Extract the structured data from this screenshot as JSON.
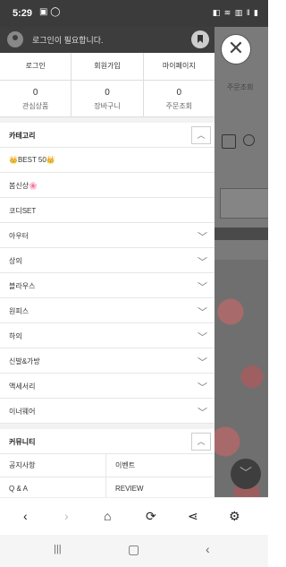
{
  "status": {
    "time": "5:29",
    "left_icons": "▣ ◯",
    "right_icons": "◧ ≋ ▥ ‖ ▮"
  },
  "drawer": {
    "login_msg": "로그인이 필요합니다.",
    "top_links": [
      "로그인",
      "회원가입",
      "마이페이지"
    ],
    "counts": [
      {
        "value": "0",
        "label": "관심상품"
      },
      {
        "value": "0",
        "label": "장바구니"
      },
      {
        "value": "0",
        "label": "주문조회"
      }
    ],
    "category_title": "카테고리",
    "categories": [
      {
        "label": "👑BEST 50👑",
        "chevron": false
      },
      {
        "label": "봄신상🌸",
        "chevron": false
      },
      {
        "label": "코디SET",
        "chevron": false
      },
      {
        "label": "아우터",
        "chevron": true
      },
      {
        "label": "상의",
        "chevron": true
      },
      {
        "label": "블라우스",
        "chevron": true
      },
      {
        "label": "원피스",
        "chevron": true
      },
      {
        "label": "하의",
        "chevron": true
      },
      {
        "label": "신발&가방",
        "chevron": true
      },
      {
        "label": "액세서리",
        "chevron": true
      },
      {
        "label": "이너웨어",
        "chevron": true
      }
    ],
    "community_title": "커뮤니티",
    "community": [
      "공지사항",
      "이벤트",
      "Q & A",
      "REVIEW"
    ]
  },
  "background": {
    "text": "주문조회"
  },
  "icons": {
    "close": "✕",
    "up": "︿",
    "down": "﹀",
    "back": "‹",
    "forward": "›",
    "home": "⌂",
    "refresh": "⟳",
    "share": "⋖",
    "settings": "⚙",
    "nav_recent": "|||",
    "nav_home": "▢",
    "nav_back": "‹"
  }
}
